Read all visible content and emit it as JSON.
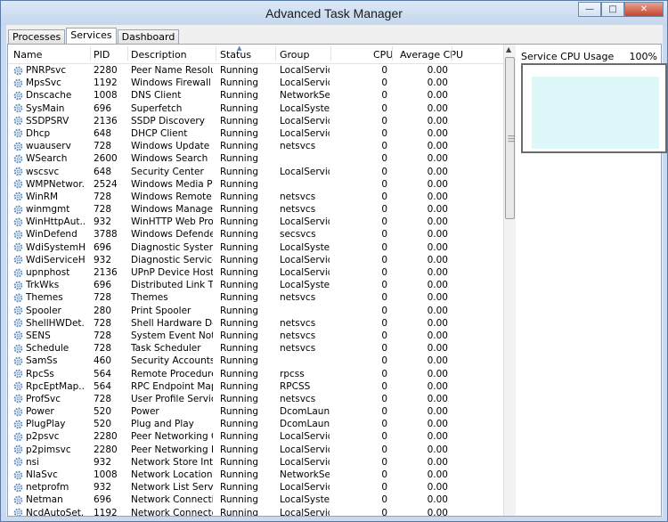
{
  "window": {
    "title": "Advanced Task Manager"
  },
  "tabs": [
    "Processes",
    "Services",
    "Dashboard"
  ],
  "active_tab": "Services",
  "columns": {
    "name": "Name",
    "pid": "PID",
    "description": "Description",
    "status": "Status",
    "group": "Group",
    "cpu": "CPU",
    "avg_cpu": "Average CPU"
  },
  "services": [
    {
      "name": "PNRPsvc",
      "pid": "2280",
      "description": "Peer Name Resolut...",
      "status": "Running",
      "group": "LocalServic...",
      "cpu": "0",
      "avg": "0.00"
    },
    {
      "name": "MpsSvc",
      "pid": "1192",
      "description": "Windows Firewall",
      "status": "Running",
      "group": "LocalServic...",
      "cpu": "0",
      "avg": "0.00"
    },
    {
      "name": "Dnscache",
      "pid": "1008",
      "description": "DNS Client",
      "status": "Running",
      "group": "NetworkSe...",
      "cpu": "0",
      "avg": "0.00"
    },
    {
      "name": "SysMain",
      "pid": "696",
      "description": "Superfetch",
      "status": "Running",
      "group": "LocalSyste...",
      "cpu": "0",
      "avg": "0.00"
    },
    {
      "name": "SSDPSRV",
      "pid": "2136",
      "description": "SSDP Discovery",
      "status": "Running",
      "group": "LocalServic...",
      "cpu": "0",
      "avg": "0.00"
    },
    {
      "name": "Dhcp",
      "pid": "648",
      "description": "DHCP Client",
      "status": "Running",
      "group": "LocalServic...",
      "cpu": "0",
      "avg": "0.00"
    },
    {
      "name": "wuauserv",
      "pid": "728",
      "description": "Windows Update",
      "status": "Running",
      "group": "netsvcs",
      "cpu": "0",
      "avg": "0.00"
    },
    {
      "name": "WSearch",
      "pid": "2600",
      "description": "Windows Search",
      "status": "Running",
      "group": "",
      "cpu": "0",
      "avg": "0.00"
    },
    {
      "name": "wscsvc",
      "pid": "648",
      "description": "Security Center",
      "status": "Running",
      "group": "LocalServic...",
      "cpu": "0",
      "avg": "0.00"
    },
    {
      "name": "WMPNetwor...",
      "pid": "2524",
      "description": "Windows Media Pl...",
      "status": "Running",
      "group": "",
      "cpu": "0",
      "avg": "0.00"
    },
    {
      "name": "WinRM",
      "pid": "728",
      "description": "Windows Remote ...",
      "status": "Running",
      "group": "netsvcs",
      "cpu": "0",
      "avg": "0.00"
    },
    {
      "name": "winmgmt",
      "pid": "728",
      "description": "Windows Manage...",
      "status": "Running",
      "group": "netsvcs",
      "cpu": "0",
      "avg": "0.00"
    },
    {
      "name": "WinHttpAut...",
      "pid": "932",
      "description": "WinHTTP Web Prox...",
      "status": "Running",
      "group": "LocalService",
      "cpu": "0",
      "avg": "0.00"
    },
    {
      "name": "WinDefend",
      "pid": "3788",
      "description": "Windows Defender",
      "status": "Running",
      "group": "secsvcs",
      "cpu": "0",
      "avg": "0.00"
    },
    {
      "name": "WdiSystemH...",
      "pid": "696",
      "description": "Diagnostic System ...",
      "status": "Running",
      "group": "LocalSyste...",
      "cpu": "0",
      "avg": "0.00"
    },
    {
      "name": "WdiServiceH...",
      "pid": "932",
      "description": "Diagnostic Service ...",
      "status": "Running",
      "group": "LocalService",
      "cpu": "0",
      "avg": "0.00"
    },
    {
      "name": "upnphost",
      "pid": "2136",
      "description": "UPnP Device Host",
      "status": "Running",
      "group": "LocalServic...",
      "cpu": "0",
      "avg": "0.00"
    },
    {
      "name": "TrkWks",
      "pid": "696",
      "description": "Distributed Link Tr...",
      "status": "Running",
      "group": "LocalSyste...",
      "cpu": "0",
      "avg": "0.00"
    },
    {
      "name": "Themes",
      "pid": "728",
      "description": "Themes",
      "status": "Running",
      "group": "netsvcs",
      "cpu": "0",
      "avg": "0.00"
    },
    {
      "name": "Spooler",
      "pid": "280",
      "description": "Print Spooler",
      "status": "Running",
      "group": "",
      "cpu": "0",
      "avg": "0.00"
    },
    {
      "name": "ShellHWDet...",
      "pid": "728",
      "description": "Shell Hardware De...",
      "status": "Running",
      "group": "netsvcs",
      "cpu": "0",
      "avg": "0.00"
    },
    {
      "name": "SENS",
      "pid": "728",
      "description": "System Event Notif...",
      "status": "Running",
      "group": "netsvcs",
      "cpu": "0",
      "avg": "0.00"
    },
    {
      "name": "Schedule",
      "pid": "728",
      "description": "Task Scheduler",
      "status": "Running",
      "group": "netsvcs",
      "cpu": "0",
      "avg": "0.00"
    },
    {
      "name": "SamSs",
      "pid": "460",
      "description": "Security Accounts ...",
      "status": "Running",
      "group": "",
      "cpu": "0",
      "avg": "0.00"
    },
    {
      "name": "RpcSs",
      "pid": "564",
      "description": "Remote Procedure ...",
      "status": "Running",
      "group": "rpcss",
      "cpu": "0",
      "avg": "0.00"
    },
    {
      "name": "RpcEptMap...",
      "pid": "564",
      "description": "RPC Endpoint Map...",
      "status": "Running",
      "group": "RPCSS",
      "cpu": "0",
      "avg": "0.00"
    },
    {
      "name": "ProfSvc",
      "pid": "728",
      "description": "User Profile Service",
      "status": "Running",
      "group": "netsvcs",
      "cpu": "0",
      "avg": "0.00"
    },
    {
      "name": "Power",
      "pid": "520",
      "description": "Power",
      "status": "Running",
      "group": "DcomLaunch",
      "cpu": "0",
      "avg": "0.00"
    },
    {
      "name": "PlugPlay",
      "pid": "520",
      "description": "Plug and Play",
      "status": "Running",
      "group": "DcomLaunch",
      "cpu": "0",
      "avg": "0.00"
    },
    {
      "name": "p2psvc",
      "pid": "2280",
      "description": "Peer Networking G...",
      "status": "Running",
      "group": "LocalServic...",
      "cpu": "0",
      "avg": "0.00"
    },
    {
      "name": "p2pimsvc",
      "pid": "2280",
      "description": "Peer Networking I...",
      "status": "Running",
      "group": "LocalServic...",
      "cpu": "0",
      "avg": "0.00"
    },
    {
      "name": "nsi",
      "pid": "932",
      "description": "Network Store Inte...",
      "status": "Running",
      "group": "LocalService",
      "cpu": "0",
      "avg": "0.00"
    },
    {
      "name": "NlaSvc",
      "pid": "1008",
      "description": "Network Location ...",
      "status": "Running",
      "group": "NetworkSe...",
      "cpu": "0",
      "avg": "0.00"
    },
    {
      "name": "netprofm",
      "pid": "932",
      "description": "Network List Service",
      "status": "Running",
      "group": "LocalService",
      "cpu": "0",
      "avg": "0.00"
    },
    {
      "name": "Netman",
      "pid": "696",
      "description": "Network Connecti...",
      "status": "Running",
      "group": "LocalSyste...",
      "cpu": "0",
      "avg": "0.00"
    },
    {
      "name": "NcdAutoSet...",
      "pid": "1192",
      "description": "Network Connecte...",
      "status": "Running",
      "group": "LocalServic...",
      "cpu": "0",
      "avg": "0.00"
    }
  ],
  "side_panel": {
    "title": "Service CPU Usage",
    "percent": "100%"
  },
  "colors": {
    "chart_fill": "#def7f8",
    "gear_icon": "#5b8ac4"
  },
  "icons": {
    "service": "gear-icon",
    "minimize": "minimize-icon",
    "maximize": "maximize-icon",
    "close": "close-icon"
  }
}
